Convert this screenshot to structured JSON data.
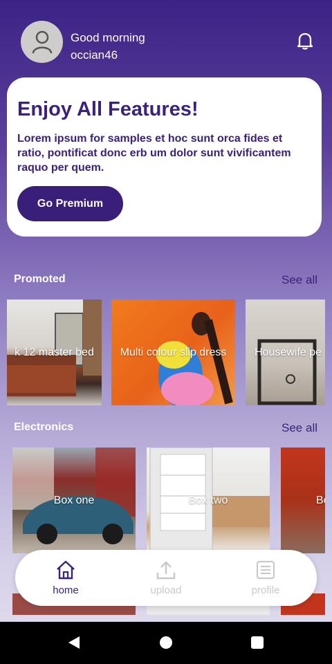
{
  "header": {
    "greeting": "Good morning",
    "username": "occian46"
  },
  "promo": {
    "title": "Enjoy All Features!",
    "text": "Lorem ipsum for samples et hoc sunt orca fides et ratio, pontificat donc erb um dolor sunt vivificantem raquo per quem.",
    "button_label": "Go Premium"
  },
  "sections": [
    {
      "title": "Promoted",
      "see_all": "See all",
      "items": [
        {
          "label": "k 12 master bed"
        },
        {
          "label": "Multi colour slip dress"
        },
        {
          "label": "Housewife pe"
        }
      ]
    },
    {
      "title": "Electronics",
      "see_all": "See all",
      "items": [
        {
          "label": "Box one"
        },
        {
          "label": "Box two"
        },
        {
          "label": "Bo"
        }
      ]
    }
  ],
  "nav": [
    {
      "label": "home",
      "icon": "home-icon",
      "active": true
    },
    {
      "label": "upload",
      "icon": "upload-icon",
      "active": false
    },
    {
      "label": "profile",
      "icon": "list-icon",
      "active": false
    }
  ],
  "colors": {
    "accent": "#3a217c",
    "inactive": "#c9c9c9"
  }
}
